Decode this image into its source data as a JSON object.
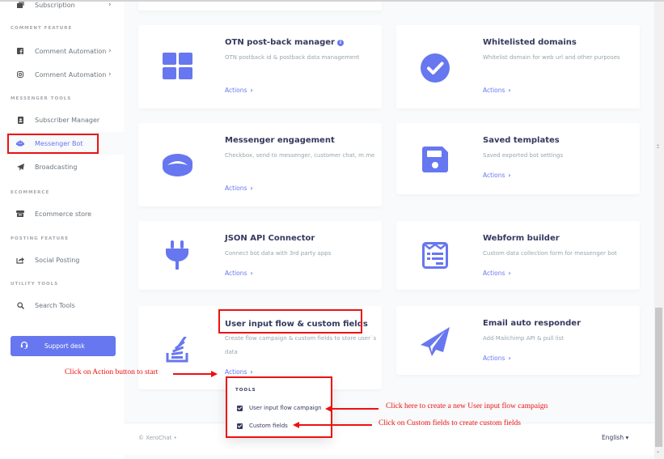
{
  "sidebar": {
    "items": [
      {
        "label": "Subscription",
        "icon": "subscription-icon",
        "has_chevron": true
      },
      {
        "label": "Comment Automation",
        "icon": "facebook-icon",
        "has_chevron": true
      },
      {
        "label": "Comment Automation",
        "icon": "instagram-icon",
        "has_chevron": true
      },
      {
        "label": "Subscriber Manager",
        "icon": "contact-card-icon",
        "has_chevron": false
      },
      {
        "label": "Messenger Bot",
        "icon": "robot-icon",
        "has_chevron": false,
        "active": true
      },
      {
        "label": "Broadcasting",
        "icon": "paper-plane-icon",
        "has_chevron": false
      },
      {
        "label": "Ecommerce store",
        "icon": "store-icon",
        "has_chevron": false
      },
      {
        "label": "Social Posting",
        "icon": "share-icon",
        "has_chevron": false
      },
      {
        "label": "Search Tools",
        "icon": "search-icon",
        "has_chevron": false
      }
    ],
    "headers": [
      "Comment Feature",
      "Messenger Tools",
      "Ecommerce",
      "Posting Feature",
      "Utility Tools"
    ],
    "chevron": "›",
    "support_label": "Support desk"
  },
  "cards": [
    {
      "title": "OTN post-back manager",
      "info": "i",
      "desc": "OTN postback id & postback data management",
      "actions": "Actions",
      "icon": "grid-icon"
    },
    {
      "title": "Whitelisted domains",
      "desc": "Whitelist domain for web url and other purposes",
      "actions": "Actions",
      "icon": "check-circle-icon"
    },
    {
      "title": "Messenger engagement",
      "desc": "Checkbox, send to messenger, customer chat, m.me",
      "actions": "Actions",
      "icon": "ring-icon"
    },
    {
      "title": "Saved templates",
      "desc": "Saved exported bot settings",
      "actions": "Actions",
      "icon": "save-icon"
    },
    {
      "title": "JSON API Connector",
      "desc": "Connect bot data with 3rd party apps",
      "actions": "Actions",
      "icon": "plug-icon"
    },
    {
      "title": "Webform builder",
      "desc": "Custom data collection form for messenger bot",
      "actions": "Actions",
      "icon": "form-icon"
    },
    {
      "title": "User input flow & custom fields",
      "desc": "Create flow campaign & custom fields to store user`s data",
      "actions": "Actions",
      "icon": "stack-icon"
    },
    {
      "title": "Email auto responder",
      "desc": "Add Mailchimp API & pull list",
      "actions": "Actions",
      "icon": "paper-plane-icon"
    }
  ],
  "actions_chevron": "›",
  "dropdown": {
    "header": "TOOLS",
    "items": [
      "User input flow campaign",
      "Custom fields"
    ]
  },
  "footer": {
    "copyright": "© XeroChat  •",
    "language": "English ▾"
  },
  "annotations": {
    "start": "Click on Action button to start",
    "campaign": "Click here to create a new User input flow campaign",
    "custom_fields": "Click on Custom fields to create custom fields"
  },
  "colors": {
    "accent": "#6777ef",
    "annotation": "#ee1111"
  }
}
